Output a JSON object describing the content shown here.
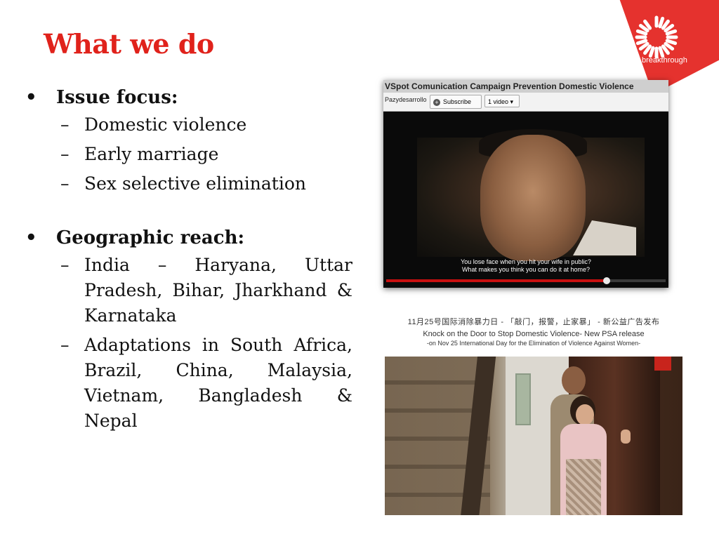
{
  "slide": {
    "title": "What we do",
    "logo_text": "breakthrough",
    "bullets": [
      {
        "heading": "Issue focus:",
        "items": [
          "Domestic violence",
          "Early marriage",
          "Sex selective elimination"
        ]
      },
      {
        "heading": "Geographic reach:",
        "items": [
          "India – Haryana, Uttar Pradesh, Bihar, Jharkhand & Karnataka",
          "Adaptations in South Africa, Brazil, China, Malaysia, Vietnam, Bangladesh & Nepal"
        ]
      }
    ],
    "bullet_mark": "•",
    "dash_mark": "–"
  },
  "video": {
    "title": "VSpot Comunication Campaign Prevention Domestic Violence",
    "channel": "Pazydesarrollo",
    "subscribe_label": "Subscribe",
    "video_count": "1 video",
    "subtitle_line1": "You lose face when you hit your wife in public?",
    "subtitle_line2": "What makes you think you can do it at home?",
    "progress": 0.79
  },
  "psa": {
    "caption_line1": "11月25号国际消除暴力日 - 「敲门，报警，止家暴」 - 新公益广告发布",
    "caption_line2": "Knock on the Door to Stop Domestic Violence- New PSA release",
    "caption_line3": "-on Nov 25 International Day for the Elimination of Violence Against Women-"
  },
  "colors": {
    "accent": "#e0221b",
    "logo_bg": "#e5322e"
  }
}
